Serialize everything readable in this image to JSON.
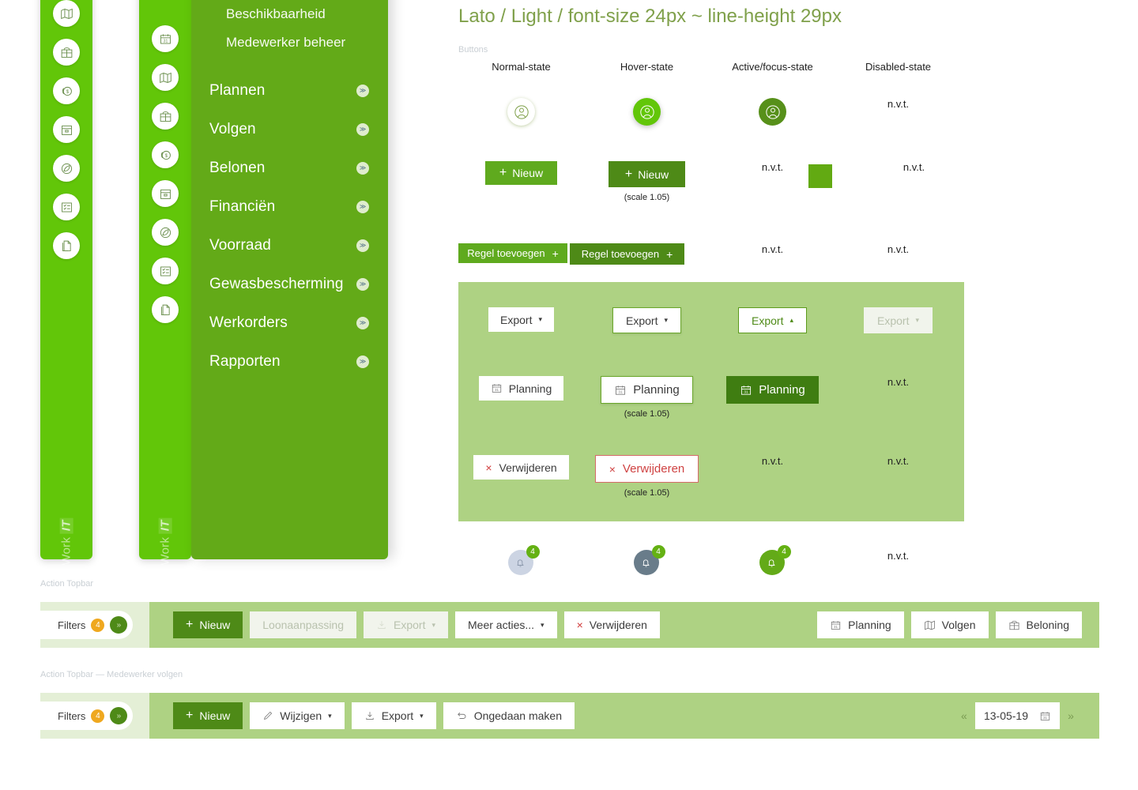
{
  "sidebar": {
    "brand": "Work",
    "brand_accent": "IT",
    "rail_icons": [
      "map-field-icon",
      "gift-grid-icon",
      "coin-dollar-icon",
      "box-archive-icon",
      "leaf-icon",
      "checklist-icon",
      "documents-icon"
    ],
    "drawer_headers": [
      "Beschikbaarheid",
      "Medewerker beheer"
    ],
    "menu": [
      {
        "label": "Plannen",
        "icon": "calendar-31-icon"
      },
      {
        "label": "Volgen",
        "icon": "map-field-icon"
      },
      {
        "label": "Belonen",
        "icon": "gift-grid-icon"
      },
      {
        "label": "Financiën",
        "icon": "coin-dollar-icon"
      },
      {
        "label": "Voorraad",
        "icon": "box-archive-icon"
      },
      {
        "label": "Gewasbescherming",
        "icon": "leaf-icon"
      },
      {
        "label": "Werkorders",
        "icon": "checklist-icon"
      },
      {
        "label": "Rapporten",
        "icon": "documents-icon"
      }
    ],
    "chevron_glyph": "≫"
  },
  "typography": {
    "title": "Lato / Light / font-size 24px ~ line-height 29px"
  },
  "buttons_section": {
    "caption": "Buttons",
    "states": [
      "Normal-state",
      "Hover-state",
      "Active/focus-state",
      "Disabled-state"
    ],
    "na": "n.v.t.",
    "scale_note": "(scale 1.05)",
    "rows": {
      "avatar": {
        "icon": "user-circle-icon"
      },
      "nieuw": {
        "label": "Nieuw",
        "plus": "+"
      },
      "regel": {
        "label": "Regel toevoegen",
        "plus": "+"
      },
      "export": {
        "label": "Export",
        "caret_down": "▾",
        "caret_up": "▴"
      },
      "planning": {
        "label": "Planning",
        "icon": "calendar-31-icon"
      },
      "verwijderen": {
        "label": "Verwijderen",
        "x": "×"
      },
      "bell": {
        "icon": "bell-icon",
        "count": "4"
      }
    }
  },
  "topbar1": {
    "caption": "Action Topbar",
    "filters": {
      "label": "Filters",
      "count": "4",
      "expand": "»"
    },
    "left_buttons": [
      {
        "label": "Nieuw",
        "icon": "plus-icon",
        "style": "primary"
      },
      {
        "label": "Loonaanpassing",
        "icon": "",
        "style": "disabled"
      },
      {
        "label": "Export",
        "icon": "download-icon",
        "style": "disabled",
        "caret": "▾"
      },
      {
        "label": "Meer acties...",
        "icon": "",
        "style": "normal",
        "caret": "▾"
      },
      {
        "label": "Verwijderen",
        "icon": "x-icon",
        "style": "normal"
      }
    ],
    "right_buttons": [
      {
        "label": "Planning",
        "icon": "calendar-31-icon"
      },
      {
        "label": "Volgen",
        "icon": "map-field-icon"
      },
      {
        "label": "Beloning",
        "icon": "gift-grid-icon"
      }
    ]
  },
  "topbar2": {
    "caption": "Action Topbar — Medewerker volgen",
    "filters": {
      "label": "Filters",
      "count": "4",
      "expand": "»"
    },
    "left_buttons": [
      {
        "label": "Nieuw",
        "icon": "plus-icon",
        "style": "primary"
      },
      {
        "label": "Wijzigen",
        "icon": "pencil-icon",
        "style": "normal",
        "caret": "▾"
      },
      {
        "label": "Export",
        "icon": "download-icon",
        "style": "normal",
        "caret": "▾"
      },
      {
        "label": "Ongedaan maken",
        "icon": "undo-icon",
        "style": "normal"
      }
    ],
    "datepicker": {
      "prev": "«",
      "next": "»",
      "value": "13-05-19",
      "icon": "calendar-31-icon"
    }
  },
  "colors": {
    "brand_green": "#62c609",
    "drawer_green": "#63aa18",
    "primary_green": "#5faa1e",
    "hover_green": "#4e8a17",
    "active_green": "#3f7d11",
    "panel_green": "#aed283",
    "topbar_green": "#aed283",
    "filters_zone": "#e4efd6",
    "badge_orange": "#efa81f",
    "danger_red": "#d13b3b",
    "title_green": "#7fa04a",
    "caption_grey": "#c9cfd4"
  }
}
